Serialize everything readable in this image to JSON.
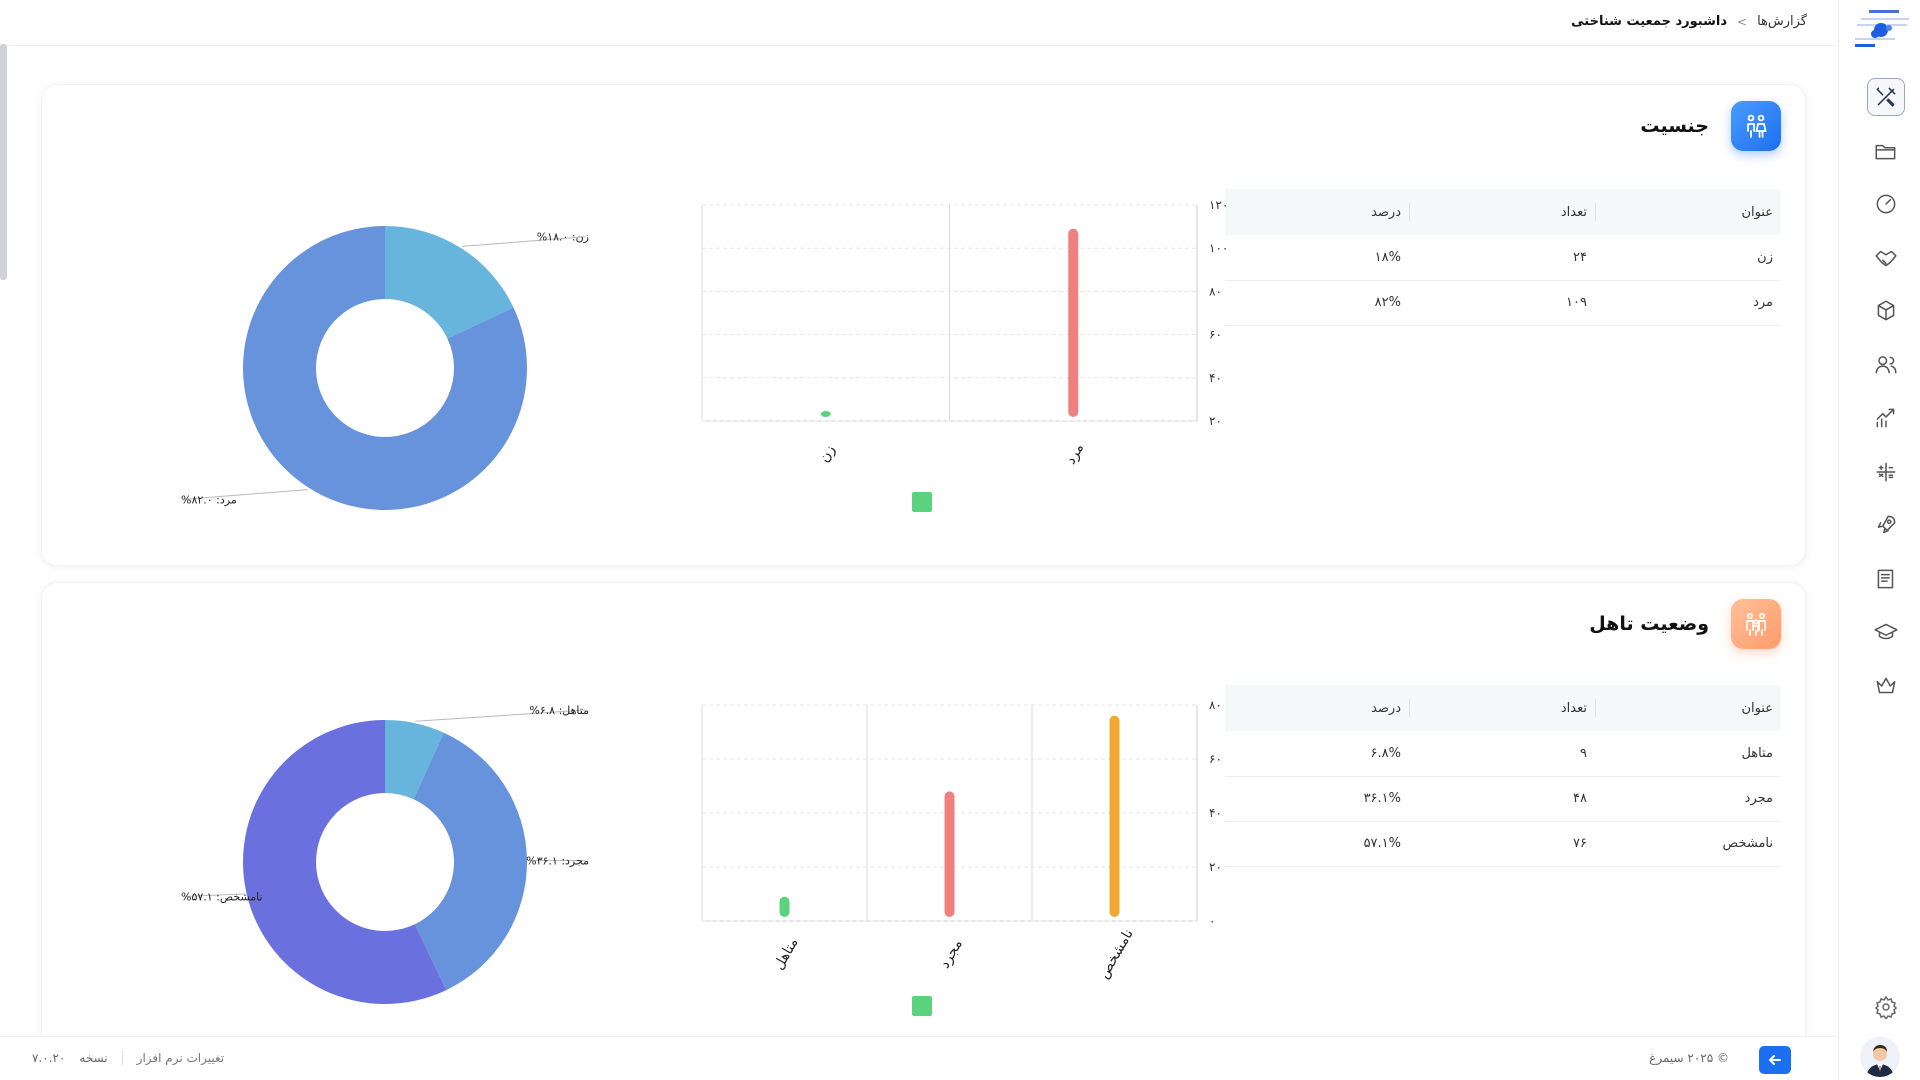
{
  "breadcrumb": {
    "root": "گزارش‌ها",
    "separator": ">",
    "current": "داشبورد جمعیت شناختی"
  },
  "sidebar": {
    "items": [
      {
        "icon": "tools-icon",
        "active": true
      },
      {
        "icon": "folder-icon",
        "active": false
      },
      {
        "icon": "gauge-icon",
        "active": false
      },
      {
        "icon": "handshake-icon",
        "active": false
      },
      {
        "icon": "cubes-icon",
        "active": false
      },
      {
        "icon": "users-icon",
        "active": false
      },
      {
        "icon": "chart-growth-icon",
        "active": false
      },
      {
        "icon": "calculator-icon",
        "active": false
      },
      {
        "icon": "rocket-icon",
        "active": false
      },
      {
        "icon": "book-icon",
        "active": false
      },
      {
        "icon": "graduation-cap-icon",
        "active": false
      },
      {
        "icon": "crown-icon",
        "active": false
      }
    ]
  },
  "gender": {
    "title": "جنسیت",
    "table": {
      "headers": {
        "title": "عنوان",
        "count": "تعداد",
        "percent": "درصد"
      },
      "rows": [
        {
          "title": "زن",
          "count": "۲۴",
          "percent": "۱۸%"
        },
        {
          "title": "مرد",
          "count": "۱۰۹",
          "percent": "۸۲%"
        }
      ]
    }
  },
  "marital": {
    "title": "وضعیت تاهل",
    "table": {
      "headers": {
        "title": "عنوان",
        "count": "تعداد",
        "percent": "درصد"
      },
      "rows": [
        {
          "title": "متاهل",
          "count": "۹",
          "percent": "۶.۸%"
        },
        {
          "title": "مجرد",
          "count": "۴۸",
          "percent": "۳۶.۱%"
        },
        {
          "title": "نامشخص",
          "count": "۷۶",
          "percent": "۵۷.۱%"
        }
      ]
    }
  },
  "chart_data": [
    {
      "type": "bar",
      "categories": [
        "زن",
        "مرد"
      ],
      "values": [
        24,
        109
      ],
      "colors": [
        "#5bd37e",
        "#f08080"
      ],
      "ylim": [
        20,
        120
      ],
      "yticks": [
        "۲۰",
        "۴۰",
        "۶۰",
        "۸۰",
        "۱۰۰",
        "۱۲۰"
      ],
      "grid": true,
      "legend_color": "#5bd37e"
    },
    {
      "type": "pie",
      "categories": [
        "زن",
        "مرد"
      ],
      "values": [
        18.0,
        82.0
      ],
      "labels": [
        "زن: ۱۸.۰%",
        "مرد: ۸۲.۰%"
      ],
      "colors": [
        "#67b5dd",
        "#6793dd"
      ]
    },
    {
      "type": "bar",
      "categories": [
        "متاهل",
        "مجرد",
        "نامشخص"
      ],
      "values": [
        9,
        48,
        76
      ],
      "colors": [
        "#5bd37e",
        "#f08080",
        "#f0a830"
      ],
      "ylim": [
        0,
        80
      ],
      "yticks": [
        "۰",
        "۲۰",
        "۴۰",
        "۶۰",
        "۸۰"
      ],
      "grid": true,
      "legend_color": "#5bd37e"
    },
    {
      "type": "pie",
      "categories": [
        "متاهل",
        "مجرد",
        "نامشخص"
      ],
      "values": [
        6.8,
        36.1,
        57.1
      ],
      "labels": [
        "متاهل: ۶.۸%",
        "مجرد: ۳۶.۱%",
        "نامشخص: ۵۷.۱%"
      ],
      "colors": [
        "#67b5dd",
        "#6793dd",
        "#6a70dd"
      ]
    }
  ],
  "footer": {
    "copyright": "© ۲۰۲۵ سیمرغ",
    "software_changes": "تغییرات نرم افزار",
    "version_label": "نسخه",
    "version": "۷.۰.۲۰"
  }
}
